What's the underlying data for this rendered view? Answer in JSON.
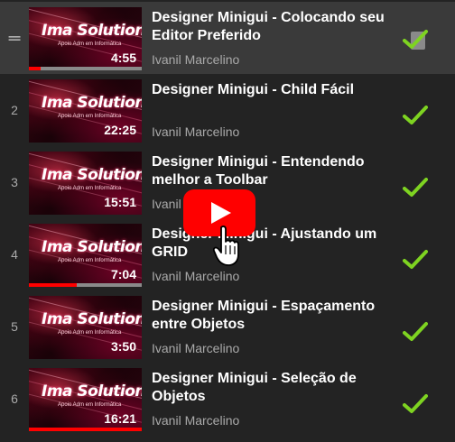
{
  "playlist": {
    "items": [
      {
        "index": "",
        "active": true,
        "title": "Designer Minigui - Colocando seu Editor Preferido",
        "author": "Ivanil Marcelino",
        "duration": "4:55",
        "progress": 0.1,
        "watched": true
      },
      {
        "index": "2",
        "active": false,
        "title": "Designer Minigui - Child Fácil",
        "author": "Ivanil Marcelino",
        "duration": "22:25",
        "progress": 0,
        "watched": true
      },
      {
        "index": "3",
        "active": false,
        "title": "Designer Minigui - Entendendo melhor a Toolbar",
        "author": "Ivanil Marcelino",
        "duration": "15:51",
        "progress": 0,
        "watched": true
      },
      {
        "index": "4",
        "active": false,
        "title": "Designer Minigui - Ajustando um GRID",
        "author": "Ivanil Marcelino",
        "duration": "7:04",
        "progress": 0.42,
        "watched": true
      },
      {
        "index": "5",
        "active": false,
        "title": "Designer Minigui - Espaçamento entre Objetos",
        "author": "Ivanil Marcelino",
        "duration": "3:50",
        "progress": 0,
        "watched": true
      },
      {
        "index": "6",
        "active": false,
        "title": "Designer Minigui - Seleção de Objetos",
        "author": "Ivanil Marcelino",
        "duration": "16:21",
        "progress": 1.0,
        "watched": true
      }
    ],
    "thumbnail_brand": "Ima Solutions",
    "thumbnail_tagline": "Apoio Adm em Informática",
    "drag_handle_icon": "drag-handle-icon",
    "watched_icon": "checkmark-icon",
    "overlay_icon": "youtube-play-icon",
    "cursor_icon": "hand-pointer-icon"
  },
  "colors": {
    "background": "#232323",
    "active_row": "#3a3a3a",
    "check_green": "#7ed321",
    "progress_red": "#ff0000",
    "play_red": "#ff0000"
  }
}
